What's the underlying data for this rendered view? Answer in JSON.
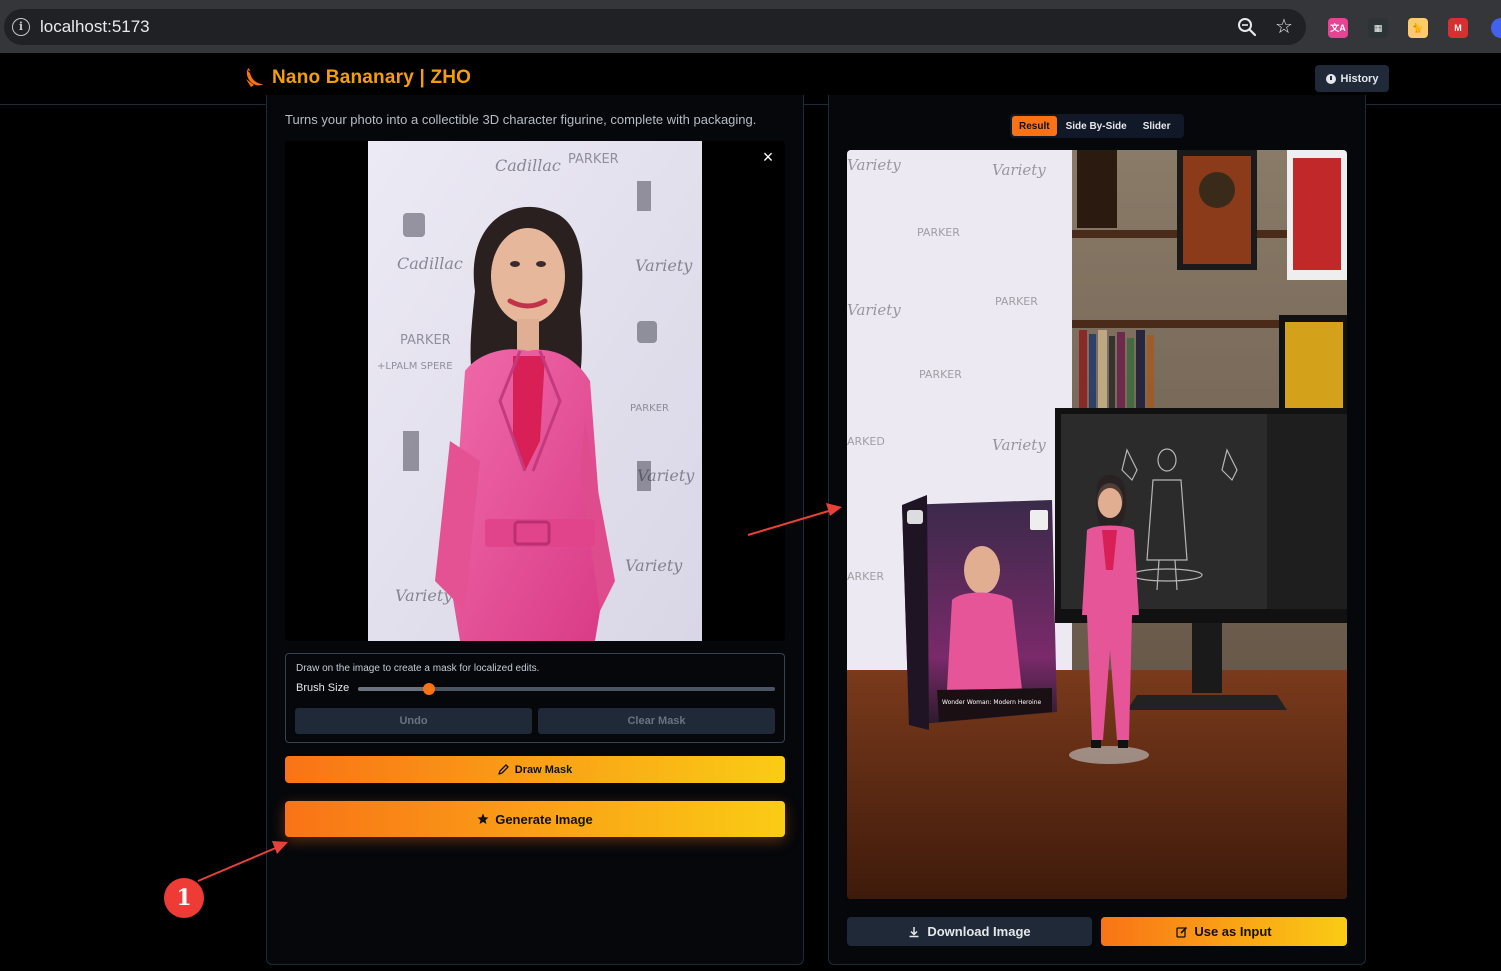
{
  "browser": {
    "url": "localhost:5173",
    "extensions": [
      {
        "name": "translate-extension-icon",
        "label": "文A",
        "color": "#e84393"
      },
      {
        "name": "extension-2-icon",
        "label": "▦",
        "color": "#2d3436"
      },
      {
        "name": "extension-3-icon",
        "label": "🐈",
        "color": "#fdcb6e"
      },
      {
        "name": "extension-4-icon",
        "label": "M",
        "color": "#d63031"
      }
    ]
  },
  "header": {
    "title": "Nano Bananary | ZHO",
    "history_label": "History"
  },
  "left": {
    "description": "Turns your photo into a collectible 3D character figurine, complete with packaging.",
    "close_symbol": "×",
    "mask": {
      "info": "Draw on the image to create a mask for localized edits.",
      "brush_label": "Brush Size",
      "brush_value": 0.17,
      "undo_label": "Undo",
      "clear_label": "Clear Mask"
    },
    "draw_mask_label": "Draw Mask",
    "generate_label": "Generate Image"
  },
  "right": {
    "tabs": [
      "Result",
      "Side By-Side",
      "Slider"
    ],
    "active_tab": 0,
    "download_label": "Download Image",
    "use_input_label": "Use as Input"
  },
  "annotation": {
    "badge": "1"
  },
  "colors": {
    "accent": "#f97316",
    "accent_end": "#facc15",
    "panel_border": "#1f2937"
  }
}
